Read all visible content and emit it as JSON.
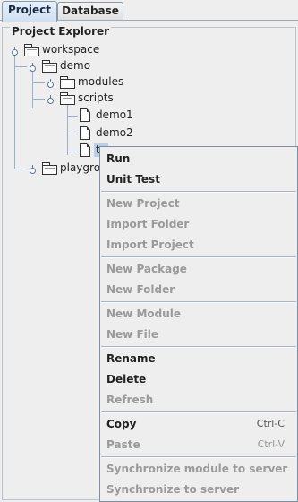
{
  "tabs": [
    {
      "label": "Project",
      "active": true
    },
    {
      "label": "Database",
      "active": false
    }
  ],
  "panel": {
    "title": "Project Explorer"
  },
  "tree": {
    "workspace": "workspace",
    "demo": "demo",
    "modules": "modules",
    "scripts": "scripts",
    "demo1": "demo1",
    "demo2": "demo2",
    "selected_partial": "te",
    "playground_partial": "playgrou"
  },
  "menu": {
    "run": "Run",
    "unit_test": "Unit Test",
    "new_project": "New Project",
    "import_folder": "Import Folder",
    "import_project": "Import Project",
    "new_package": "New Package",
    "new_folder": "New Folder",
    "new_module": "New Module",
    "new_file": "New File",
    "rename": "Rename",
    "delete": "Delete",
    "refresh": "Refresh",
    "copy": "Copy",
    "copy_shortcut": "Ctrl-C",
    "paste": "Paste",
    "paste_shortcut": "Ctrl-V",
    "sync_module": "Synchronize module to server",
    "sync_all": "Synchronize to server"
  },
  "colors": {
    "selection": "#b8cfe5",
    "disabled_text": "#9a9a9a",
    "tab_active": "#cfe0f2"
  }
}
